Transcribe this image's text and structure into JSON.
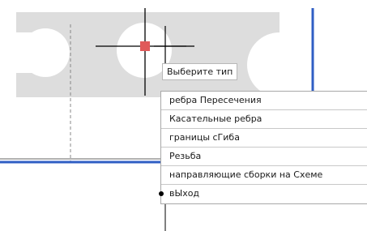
{
  "tooltip": {
    "text": "Выберите тип"
  },
  "menu": {
    "items": [
      {
        "label": "ребра Пересечения",
        "selected": false
      },
      {
        "label": "Касательные ребра",
        "selected": false
      },
      {
        "label": "границы сГиба",
        "selected": false
      },
      {
        "label": "Резьба",
        "selected": false
      },
      {
        "label": "направляющие сборки на Схеме",
        "selected": false
      },
      {
        "label": "вЫход",
        "selected": true
      }
    ]
  },
  "colors": {
    "part_fill": "#dddddd",
    "border_line": "#2f5ec4",
    "snap_marker": "#e05a5a",
    "crosshair": "#000000"
  }
}
